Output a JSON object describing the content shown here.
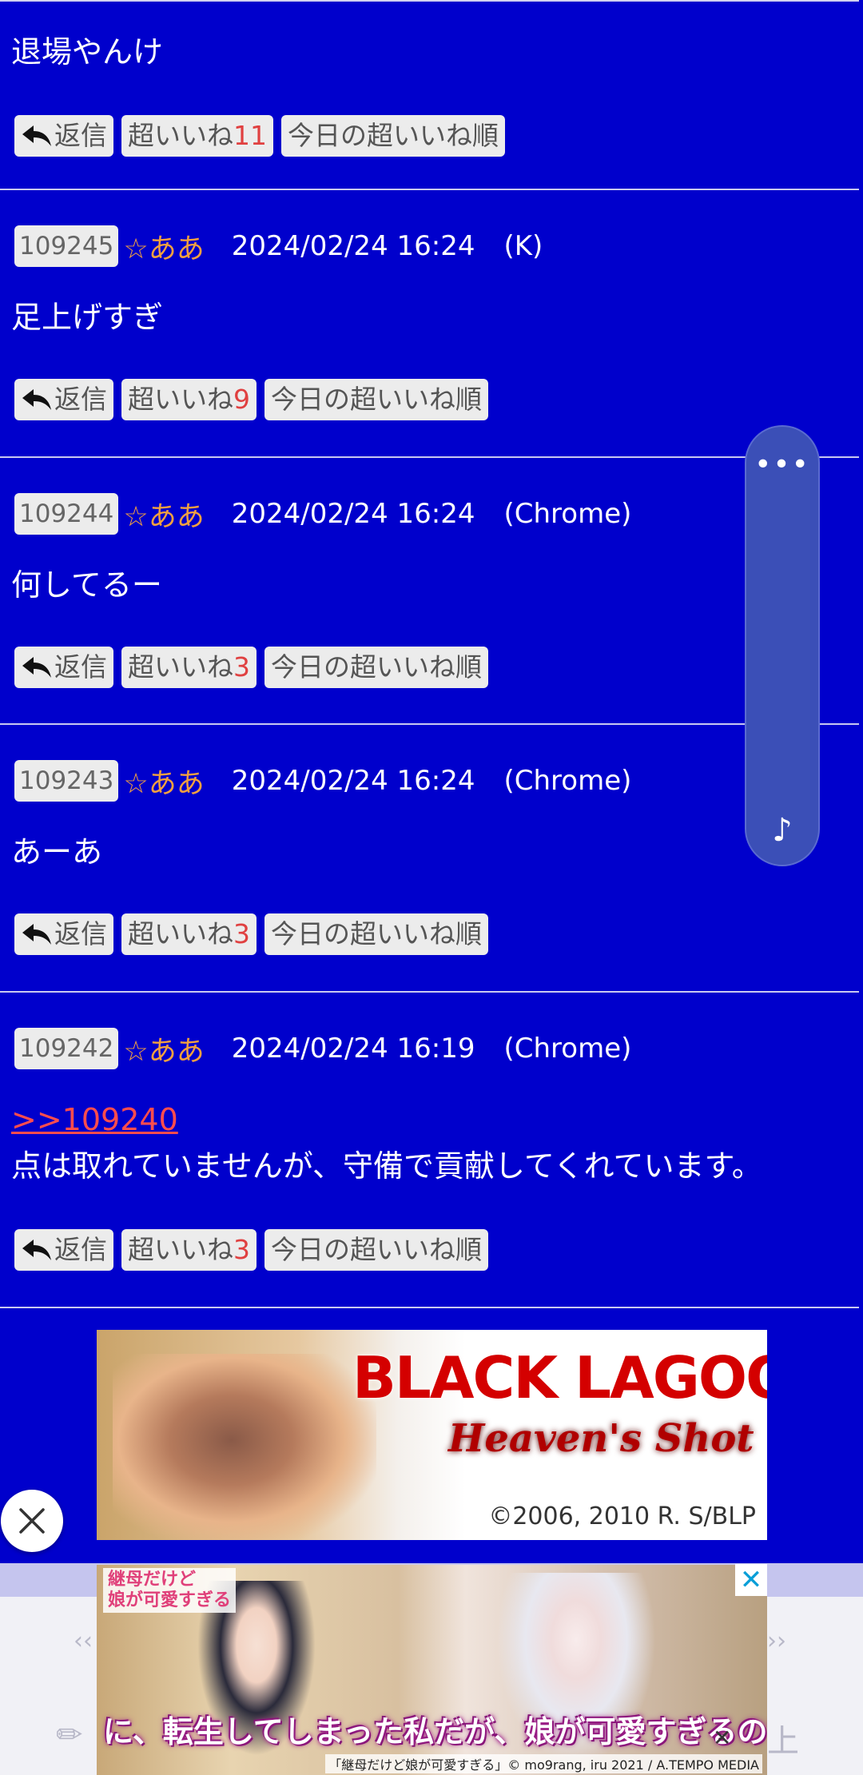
{
  "first_post": {
    "body": "退場やんけ",
    "actions": {
      "reply": "返信",
      "like_label": "超いいね",
      "like_count": "11",
      "today_sort": "今日の超いいね順"
    }
  },
  "posts": [
    {
      "no": "109245",
      "name": "☆ああ",
      "date": "2024/02/24 16:24",
      "ua": "(K)",
      "reply_to": "",
      "body": "足上げすぎ",
      "like_count": "9"
    },
    {
      "no": "109244",
      "name": "☆ああ",
      "date": "2024/02/24 16:24",
      "ua": "(Chrome)",
      "reply_to": "",
      "body": "何してるー",
      "like_count": "3"
    },
    {
      "no": "109243",
      "name": "☆ああ",
      "date": "2024/02/24 16:24",
      "ua": "(Chrome)",
      "reply_to": "",
      "body": "あーあ",
      "like_count": "3"
    },
    {
      "no": "109242",
      "name": "☆ああ",
      "date": "2024/02/24 16:19",
      "ua": "(Chrome)",
      "reply_to": ">>109240",
      "body": "点は取れていませんが、守備で貢献してくれています。",
      "like_count": "3"
    }
  ],
  "labels": {
    "reply": "返信",
    "like": "超いいね",
    "today_sort": "今日の超いいね順"
  },
  "side_widget": {
    "menu_icon": "ellipsis-icon",
    "music_icon": "music-note-icon"
  },
  "banner_ad": {
    "title": "BLACK LAGOON",
    "subtitle": "Heaven's Shot",
    "copyright": "©2006, 2010 R. S/BLP"
  },
  "bottom_nav": {
    "prev": "‹‹",
    "next": "››",
    "up": "上"
  },
  "bottom_ad": {
    "badge": "継母だけど\n娘が可愛すぎる",
    "caption": "に、転生してしまった私だが、娘が可愛すぎるので",
    "copyright": "「継母だけど娘が可愛すぎる」© mo9rang, iru 2021 / A.TEMPO MEDIA",
    "close_glyph": "✕",
    "mute_glyph": "✕"
  },
  "colors": {
    "page_bg": "#0000cc",
    "name_color": "#f2a040",
    "count_color": "#e04040",
    "link_color": "#ff4d4d"
  }
}
